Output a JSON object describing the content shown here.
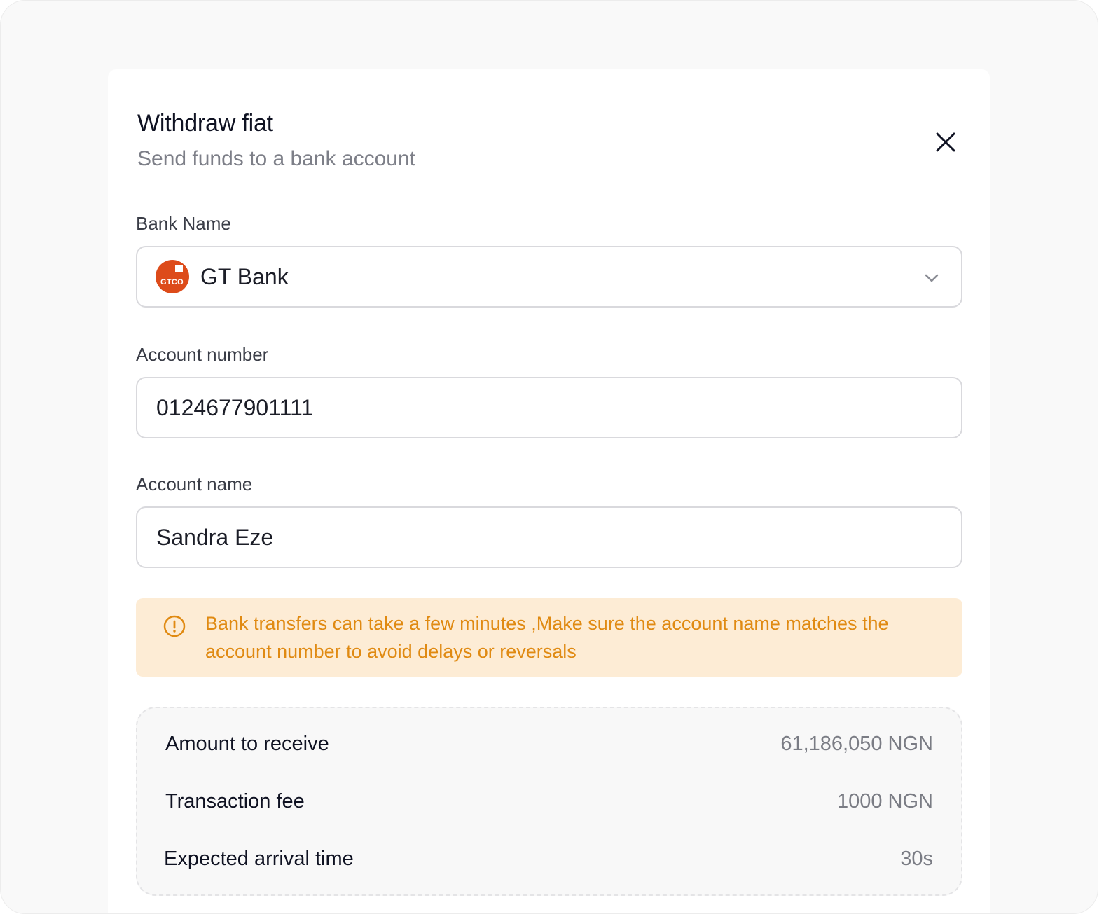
{
  "dialog": {
    "title": "Withdraw fiat",
    "subtitle": "Send funds to a bank account",
    "close_icon": "close-icon"
  },
  "bank": {
    "label": "Bank Name",
    "selected": "GT Bank",
    "logo_text": "GTCO",
    "logo_color": "#dd4b1a",
    "dropdown_icon": "chevron-down-icon"
  },
  "account_number": {
    "label": "Account number",
    "value": "0124677901111"
  },
  "account_name": {
    "label": "Account name",
    "value": "Sandra Eze"
  },
  "notice": {
    "icon": "alert-circle-icon",
    "text": "Bank transfers can take a few minutes ,Make sure the account name matches the account number to avoid delays or reversals",
    "color": "#e08a12",
    "background": "#fdecd5"
  },
  "summary": {
    "rows": [
      {
        "label": "Amount to receive",
        "value": "61,186,050 NGN"
      },
      {
        "label": "Transaction fee",
        "value": "1000 NGN"
      },
      {
        "label": "Expected arrival time",
        "value": "30s"
      }
    ]
  }
}
